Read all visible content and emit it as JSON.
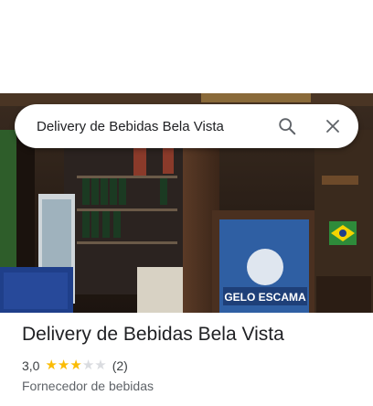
{
  "search": {
    "query": "Delivery de Bebidas Bela Vista",
    "search_icon": "search-icon",
    "close_icon": "close-icon"
  },
  "photo": {
    "sign_text": "GELO ESCAMA"
  },
  "place": {
    "title": "Delivery de Bebidas Bela Vista",
    "rating": "3,0",
    "rating_value": 3,
    "rating_max": 5,
    "review_count": "(2)",
    "category": "Fornecedor de bebidas"
  },
  "colors": {
    "star_on": "#fbbc04",
    "star_off": "#dadce0",
    "title_text": "#202124",
    "secondary_text": "#5f6368"
  }
}
